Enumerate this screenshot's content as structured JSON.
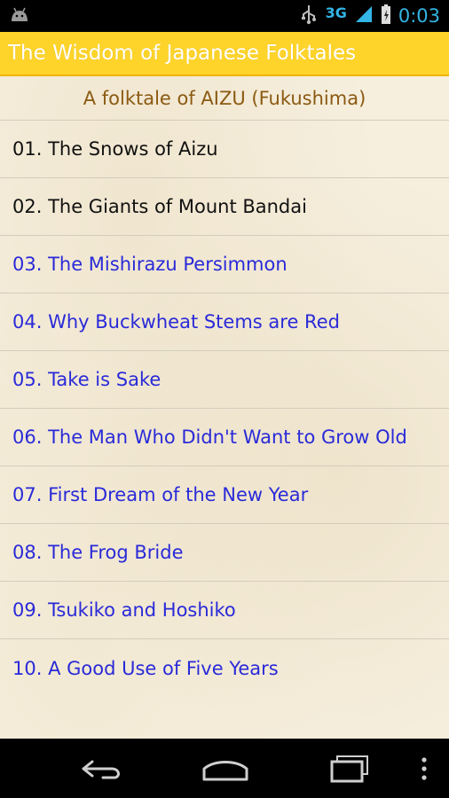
{
  "status_bar": {
    "network": "3G",
    "time": "0:03",
    "icons": [
      "android-debug-icon",
      "usb-icon",
      "signal-icon",
      "battery-icon"
    ]
  },
  "app": {
    "title": "The Wisdom of Japanese Folktales",
    "subtitle": "A folktale of AIZU (Fukushima)"
  },
  "stories": [
    {
      "label": "01. The Snows of Aizu",
      "state": "read"
    },
    {
      "label": "02. The Giants of Mount Bandai",
      "state": "read"
    },
    {
      "label": "03. The Mishirazu Persimmon",
      "state": "unread"
    },
    {
      "label": "04. Why Buckwheat Stems are Red",
      "state": "unread"
    },
    {
      "label": "05. Take is Sake",
      "state": "unread"
    },
    {
      "label": "06. The Man Who Didn't Want to Grow Old",
      "state": "unread"
    },
    {
      "label": "07. First Dream of the New Year",
      "state": "unread"
    },
    {
      "label": "08. The Frog Bride",
      "state": "unread"
    },
    {
      "label": "09. Tsukiko and Hoshiko",
      "state": "unread"
    },
    {
      "label": "10. A Good Use of Five Years",
      "state": "unread"
    }
  ],
  "colors": {
    "header": "#ffd42a",
    "subtitle": "#8b5a12",
    "read_link": "#111111",
    "unread_link": "#2a2ad8",
    "status_accent": "#33b5e5"
  },
  "nav": {
    "icons": [
      "back-icon",
      "home-icon",
      "recent-apps-icon",
      "menu-icon"
    ]
  }
}
